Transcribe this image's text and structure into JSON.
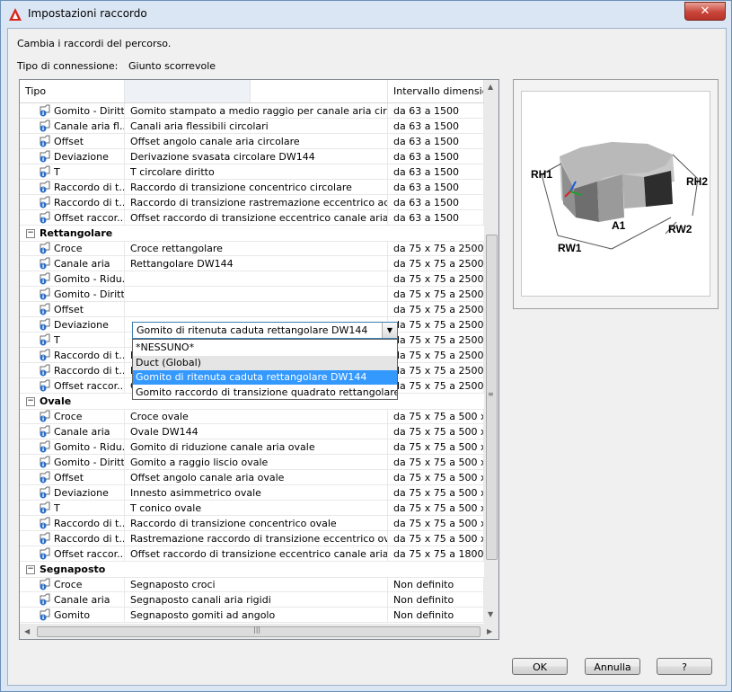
{
  "window": {
    "title": "Impostazioni raccordo",
    "close_glyph": "✕"
  },
  "dialog": {
    "instruction": "Cambia i raccordi del percorso.",
    "connection_label": "Tipo di connessione:",
    "connection_value": "Giunto scorrevole"
  },
  "grid": {
    "headers": [
      "Tipo",
      "",
      "Intervallo dimensio..."
    ],
    "rows": [
      {
        "kind": "item",
        "type": "Gomito - Diritta",
        "desc": "Gomito stampato a medio raggio per canale aria circolar...",
        "range": "da 63 a 1500"
      },
      {
        "kind": "item",
        "type": "Canale aria fl...",
        "desc": "Canali aria flessibili circolari",
        "range": "da 63 a 1500"
      },
      {
        "kind": "item",
        "type": "Offset",
        "desc": "Offset angolo canale aria circolare",
        "range": "da 63 a 1500"
      },
      {
        "kind": "item",
        "type": "Deviazione",
        "desc": "Derivazione svasata circolare DW144",
        "range": "da 63 a 1500"
      },
      {
        "kind": "item",
        "type": "T",
        "desc": "T circolare diritto",
        "range": "da 63 a 1500"
      },
      {
        "kind": "item",
        "type": "Raccordo di t...",
        "desc": "Raccordo di transizione concentrico circolare",
        "range": "da 63 a 1500"
      },
      {
        "kind": "item",
        "type": "Raccordo di t...",
        "desc": "Raccordo di transizione rastremazione eccentrico ad an...",
        "range": "da 63 a 1500"
      },
      {
        "kind": "item",
        "type": "Offset raccor...",
        "desc": "Offset raccordo di transizione eccentrico canale aria circ...",
        "range": "da 63 a 1500"
      },
      {
        "kind": "group",
        "label": "Rettangolare",
        "toggle": "−"
      },
      {
        "kind": "item",
        "type": "Croce",
        "desc": "Croce rettangolare",
        "range": "da 75 x 75 a 2500 ..."
      },
      {
        "kind": "item",
        "type": "Canale aria",
        "desc": "Rettangolare DW144",
        "range": "da 75 x 75 a 2500 ..."
      },
      {
        "kind": "item",
        "type": "Gomito - Ridu...",
        "desc": "",
        "range": "da 75 x 75 a 2500 ..."
      },
      {
        "kind": "item",
        "type": "Gomito - Diritta",
        "desc": "",
        "range": "da 75 x 75 a 2500 ..."
      },
      {
        "kind": "item",
        "type": "Offset",
        "desc": "",
        "range": "da 75 x 75 a 2500 ..."
      },
      {
        "kind": "item",
        "type": "Deviazione",
        "desc": "",
        "range": "da 75 x 75 a 2500 ..."
      },
      {
        "kind": "item",
        "type": "T",
        "desc": "",
        "range": "da 75 x 75 a 2500 ..."
      },
      {
        "kind": "item",
        "type": "Raccordo di t...",
        "desc": "Rastremazione concentrica rettangolare",
        "range": "da 75 x 75 a 2500 ..."
      },
      {
        "kind": "item",
        "type": "Raccordo di t...",
        "desc": "Rastremazione eccentrica ad angolo rettangolare DW144",
        "range": "da 75 x 75 a 2500 ..."
      },
      {
        "kind": "item",
        "type": "Offset raccor...",
        "desc": "Offset raccordo di transizione eccentrico canale aria ret...",
        "range": "da 75 x 75 a 2500 ..."
      },
      {
        "kind": "group",
        "label": "Ovale",
        "toggle": "−"
      },
      {
        "kind": "item",
        "type": "Croce",
        "desc": "Croce ovale",
        "range": "da 75 x 75 a 500 x ..."
      },
      {
        "kind": "item",
        "type": "Canale aria",
        "desc": "Ovale DW144",
        "range": "da 75 x 75 a 500 x ..."
      },
      {
        "kind": "item",
        "type": "Gomito - Ridu...",
        "desc": "Gomito di riduzione canale aria ovale",
        "range": "da 75 x 75 a 500 x ..."
      },
      {
        "kind": "item",
        "type": "Gomito - Diritta",
        "desc": "Gomito a raggio liscio ovale",
        "range": "da 75 x 75 a 500 x ..."
      },
      {
        "kind": "item",
        "type": "Offset",
        "desc": "Offset angolo canale aria ovale",
        "range": "da 75 x 75 a 500 x ..."
      },
      {
        "kind": "item",
        "type": "Deviazione",
        "desc": "Innesto asimmetrico ovale",
        "range": "da 75 x 75 a 500 x ..."
      },
      {
        "kind": "item",
        "type": "T",
        "desc": "T conico ovale",
        "range": "da 75 x 75 a 500 x ..."
      },
      {
        "kind": "item",
        "type": "Raccordo di t...",
        "desc": "Raccordo di transizione concentrico ovale",
        "range": "da 75 x 75 a 500 x ..."
      },
      {
        "kind": "item",
        "type": "Raccordo di t...",
        "desc": "Rastremazione raccordo di transizione eccentrico ovale ...",
        "range": "da 75 x 75 a 500 x ..."
      },
      {
        "kind": "item",
        "type": "Offset raccor...",
        "desc": "Offset raccordo di transizione eccentrico canale aria ovale",
        "range": "da 75 x 75 a 1800 ..."
      },
      {
        "kind": "group",
        "label": "Segnaposto",
        "toggle": "−"
      },
      {
        "kind": "item",
        "type": "Croce",
        "desc": "Segnaposto croci",
        "range": "Non definito"
      },
      {
        "kind": "item",
        "type": "Canale aria",
        "desc": "Segnaposto canali aria rigidi",
        "range": "Non definito"
      },
      {
        "kind": "item",
        "type": "Gomito",
        "desc": "Segnaposto gomiti ad angolo",
        "range": "Non definito"
      }
    ]
  },
  "combo": {
    "value": "Gomito di ritenuta caduta rettangolare DW144",
    "arrow": "▼"
  },
  "dropdown": {
    "options": [
      {
        "label": "*NESSUNO*",
        "state": "normal"
      },
      {
        "label": "Duct (Global)",
        "state": "hover"
      },
      {
        "label": "Gomito di ritenuta caduta rettangolare DW144",
        "state": "selected"
      },
      {
        "label": "Gomito raccordo di transizione quadrato rettangolare",
        "state": "normal"
      }
    ]
  },
  "preview": {
    "labels": {
      "rh1": "RH1",
      "rh2": "RH2",
      "a1": "A1",
      "rw1": "RW1",
      "rw2": "RW2"
    }
  },
  "buttons": {
    "ok": "OK",
    "cancel": "Annulla",
    "help": "?"
  },
  "scroll": {
    "up": "▲",
    "down": "▼",
    "left": "◀",
    "right": "▶",
    "grip": "≡",
    "hgrip": "|||"
  },
  "colors": {
    "selection": "#3399ff",
    "hover": "#e5e5e5",
    "info_icon": "#2a6ec8",
    "title_logo": "#d9261c"
  }
}
